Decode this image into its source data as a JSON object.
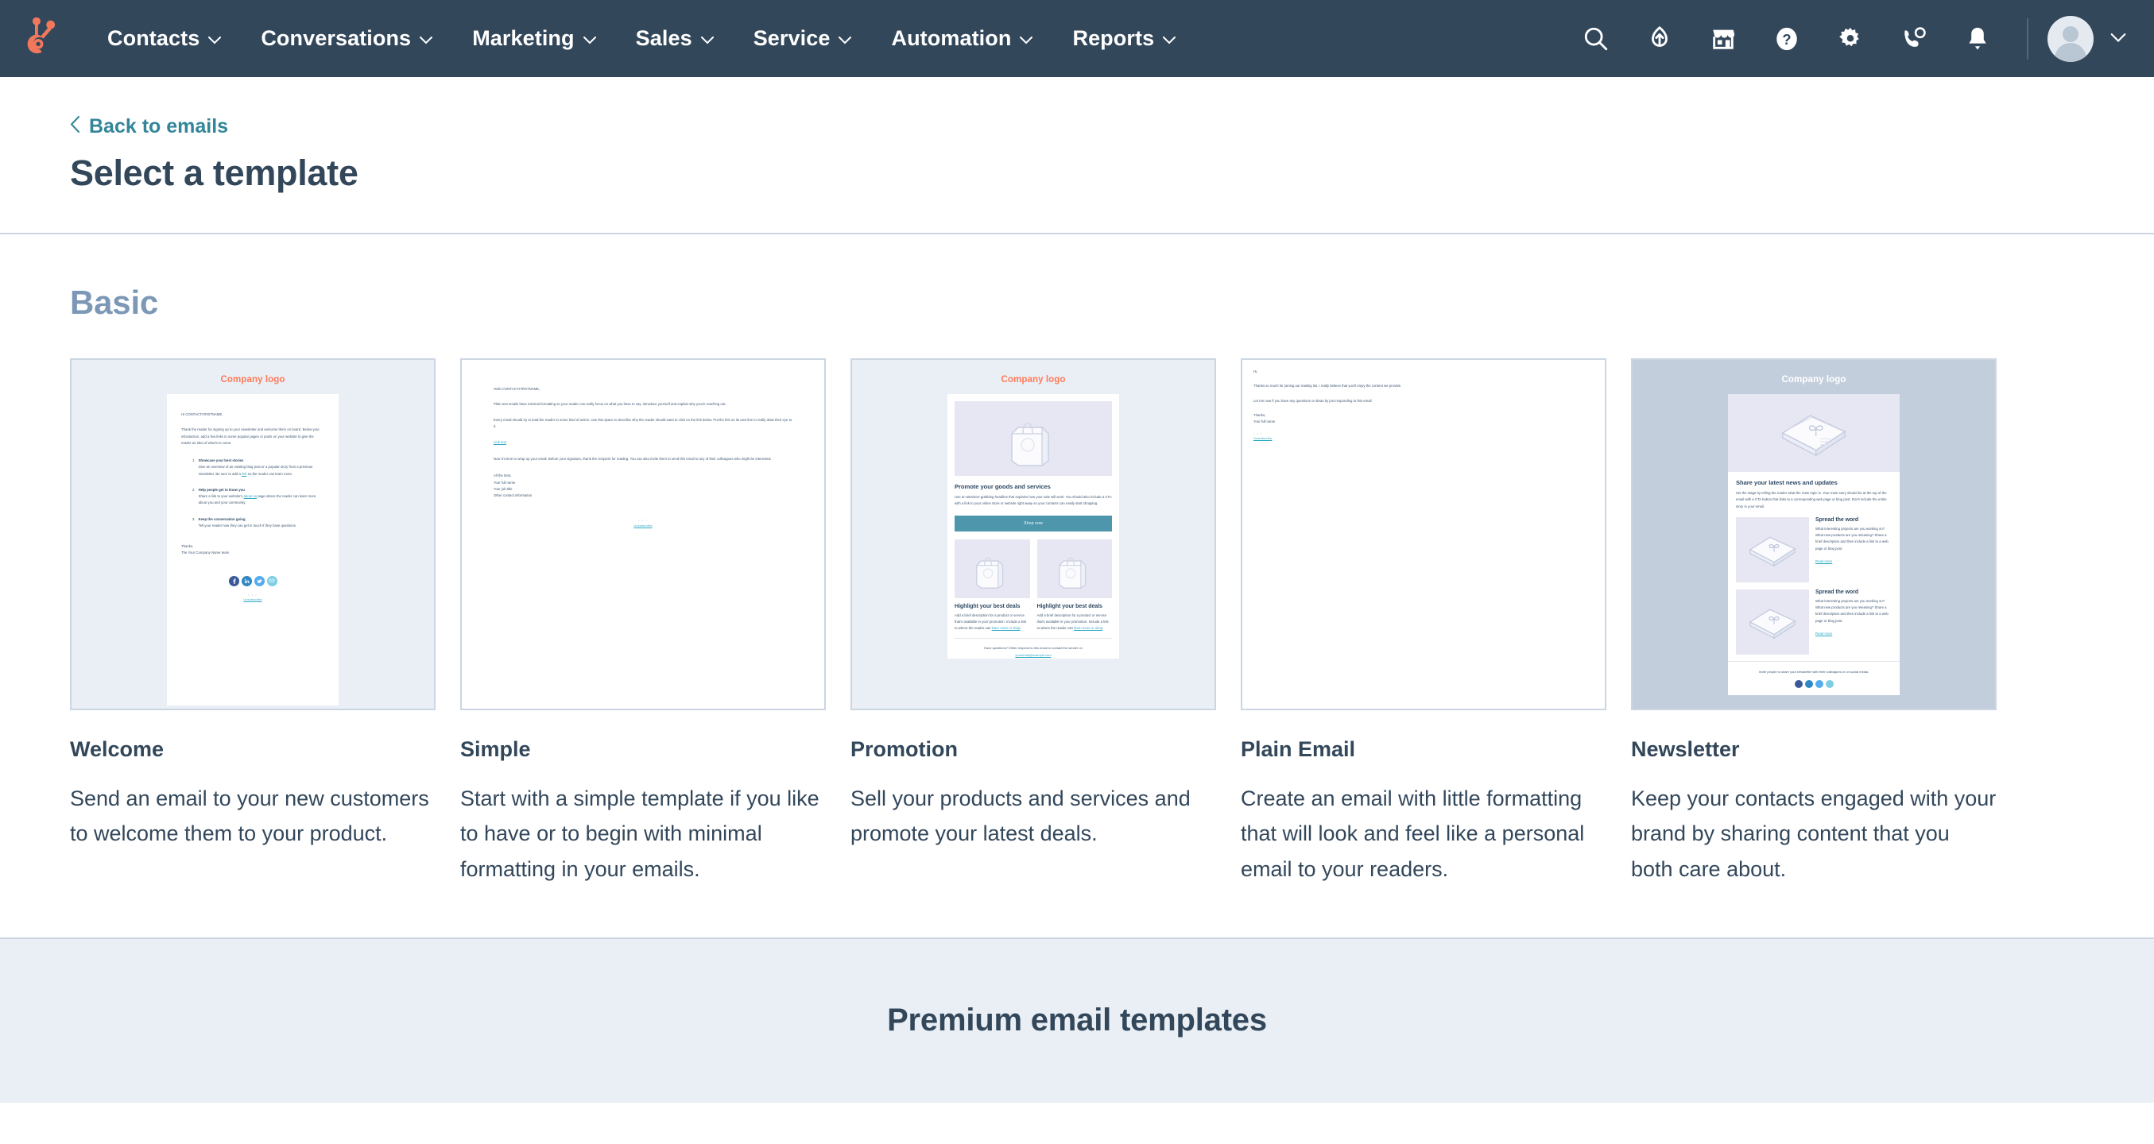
{
  "nav": {
    "logo_icon": "hubspot-sprocket-logo",
    "items": [
      {
        "label": "Contacts"
      },
      {
        "label": "Conversations"
      },
      {
        "label": "Marketing"
      },
      {
        "label": "Sales"
      },
      {
        "label": "Service"
      },
      {
        "label": "Automation"
      },
      {
        "label": "Reports"
      }
    ],
    "icons": [
      {
        "name": "search-icon"
      },
      {
        "name": "upgrade-icon"
      },
      {
        "name": "marketplace-icon"
      },
      {
        "name": "help-icon"
      },
      {
        "name": "settings-gear-icon"
      },
      {
        "name": "calling-icon"
      },
      {
        "name": "notifications-bell-icon"
      }
    ],
    "background": "#33475b"
  },
  "header": {
    "back_link": "Back to emails",
    "back_icon": "chevron-left-icon",
    "title": "Select a template",
    "link_color": "#338699",
    "title_color": "#33475b"
  },
  "basic_section": {
    "title": "Basic",
    "title_color": "#7c98b6",
    "templates": [
      {
        "name": "Welcome",
        "description": "Send an email to your new customers to welcome them to your product."
      },
      {
        "name": "Simple",
        "description": "Start with a simple template if you like to have or to begin with minimal formatting in your emails."
      },
      {
        "name": "Promotion",
        "description": "Sell your products and services and promote your latest deals."
      },
      {
        "name": "Plain Email",
        "description": "Create an email with little formatting that will look and feel like a personal email to your readers."
      },
      {
        "name": "Newsletter",
        "description": "Keep your contacts engaged with your brand by sharing content that you both care about."
      }
    ]
  },
  "premium_section": {
    "title": "Premium email templates",
    "background": "#eaeff5"
  },
  "previews": {
    "welcome": {
      "logo": "Company logo",
      "greeting": "Hi CONTACT.FIRSTNAME,",
      "intro": "Thank the reader for signing up to your newsletter and welcome them on board. Below your introduction, add a few links to some popular pages or posts on your website to give the reader an idea of what's to come.",
      "item1_title": "Showcase your best stories",
      "item1_body_a": "Give an overview of an existing blog post or a popular story from a previous newsletter. Be sure to add a ",
      "item1_link": "link",
      "item1_body_b": " so the reader can learn more.",
      "item2_title": "Help people get to know you",
      "item2_body_a": "Share a link to your website's ",
      "item2_link": "about us",
      "item2_body_b": " page where the reader can learn more about you and your community.",
      "item3_title": "Keep the conversation going",
      "item3_body": "Tell your reader how they can get in touch if they have questions.",
      "signoff": "Thanks,",
      "signature": "The Your Company Name team",
      "unsubscribe": "Unsubscribe",
      "social": [
        "facebook-icon",
        "linkedin-icon",
        "twitter-icon",
        "email-icon"
      ]
    },
    "simple": {
      "greeting": "Hello CONTACT.FIRSTNAME,",
      "para1": "Plain text emails have minimal formatting so your reader can really focus on what you have to say. Introduce yourself and explain why you're reaching out.",
      "para2": "Every email should try to lead the reader to some kind of action. Use this space to describe why the reader should want to click on the link below. Put the link on its own line to really draw their eye to it.",
      "link": "Link text",
      "para3": "Now it's time to wrap up your email. Before your signature, thank the recipient for reading. You can also invite them to send this email to any of their colleagues who might be interested.",
      "sign1": "All the best,",
      "sign2": "Your full name",
      "sign3": "Your job title",
      "sign4": "Other contact information",
      "unsubscribe": "Unsubscribe"
    },
    "promotion": {
      "logo": "Company logo",
      "heading": "Promote your goods and services",
      "body": "Use an attention-grabbing headline that explains how your sale will work. You should also include a CTA with a link to your online store or website right away so your contacts can easily start shopping.",
      "cta": "Shop now",
      "deal_title": "Highlight your best deals",
      "deal_body_a": "Add a brief description for a product or service that's available in your promotion. Include a link to where the reader can ",
      "deal_link": "learn more or shop",
      "deal_body_b": ".",
      "footer": "Have questions? Either respond to this email or contact the sender on",
      "footer_email": "youremail@example.com",
      "hero_icon": "shopping-bag-illustration"
    },
    "plain": {
      "greeting": "Hi,",
      "para1": "Thanks so much for joining our mailing list. I really believe that you'll enjoy the content we provide.",
      "para2": "Let me now if you have any questions or ideas by just responding to this email",
      "sign1": "Thanks,",
      "sign2": "Your full name",
      "unsubscribe": "Unsubscribe"
    },
    "newsletter": {
      "logo": "Company logo",
      "heading": "Share your latest news and updates",
      "body": "Set the stage by telling the reader what the main topic is. Your main story should be at the top of the email with a CTA button that links to a corresponding web page or blog post. Don't include the entire story in your email.",
      "item_title": "Spread the word",
      "item_body": "What interesting projects are you working on? What new products are you releasing? Share a brief description and then include a link to a web page or blog post.",
      "read_more": "Read more",
      "footer": "Invite people to share your newsletter with their colleagues or on social media.",
      "hero_icon": "newspaper-bundle-illustration"
    }
  }
}
